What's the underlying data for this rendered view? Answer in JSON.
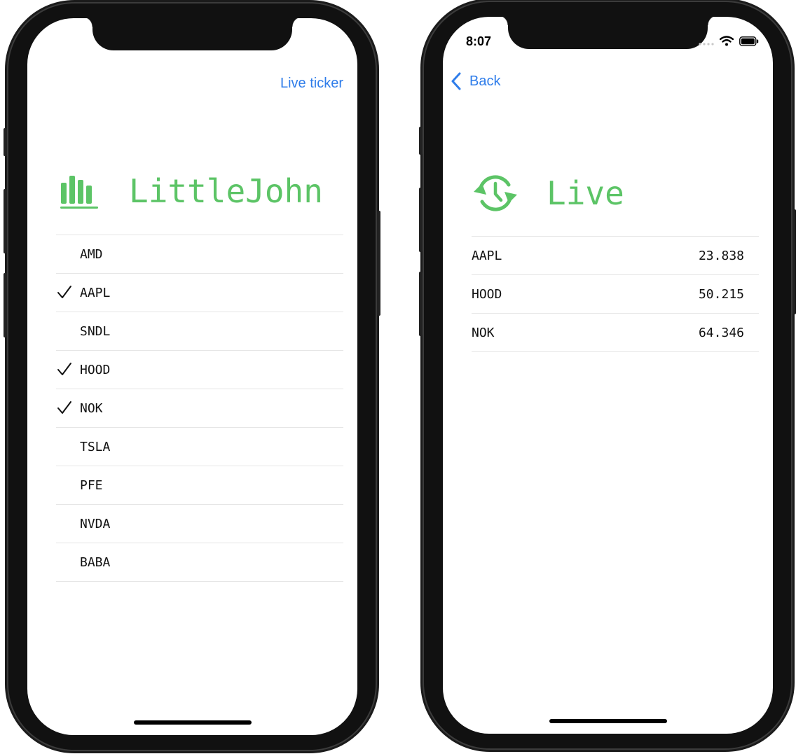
{
  "left_screen": {
    "nav": {
      "live_ticker_label": "Live ticker"
    },
    "header": {
      "icon": "chart-bars-icon",
      "title": "LittleJohn"
    },
    "symbols": [
      {
        "symbol": "AMD",
        "selected": false
      },
      {
        "symbol": "AAPL",
        "selected": true
      },
      {
        "symbol": "SNDL",
        "selected": false
      },
      {
        "symbol": "HOOD",
        "selected": true
      },
      {
        "symbol": "NOK",
        "selected": true
      },
      {
        "symbol": "TSLA",
        "selected": false
      },
      {
        "symbol": "PFE",
        "selected": false
      },
      {
        "symbol": "NVDA",
        "selected": false
      },
      {
        "symbol": "BABA",
        "selected": false
      }
    ]
  },
  "right_screen": {
    "status_bar": {
      "time": "8:07",
      "icons": [
        "signal-dots-icon",
        "wifi-icon",
        "battery-icon"
      ]
    },
    "nav": {
      "back_label": "Back",
      "back_icon": "chevron-left-icon"
    },
    "header": {
      "icon": "clock-refresh-icon",
      "title": "Live"
    },
    "tickers": [
      {
        "symbol": "AAPL",
        "price": "23.838"
      },
      {
        "symbol": "HOOD",
        "price": "50.215"
      },
      {
        "symbol": "NOK",
        "price": "64.346"
      }
    ]
  },
  "colors": {
    "accent_green": "#5cc466",
    "link_blue": "#2f7dea",
    "separator": "#e5e5e5"
  }
}
